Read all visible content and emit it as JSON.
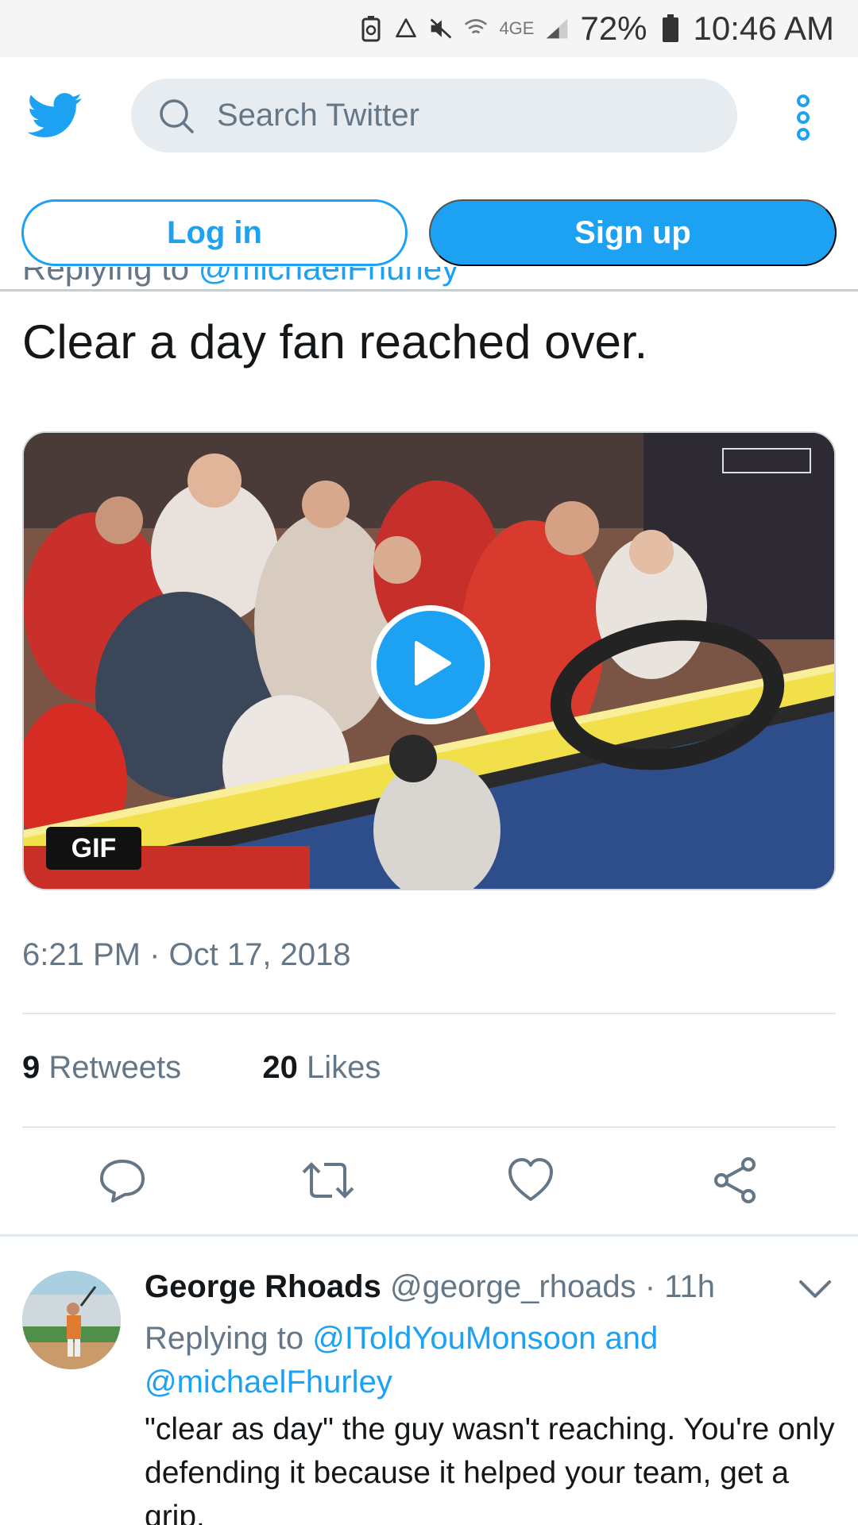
{
  "status_bar": {
    "network": "4GE",
    "battery": "72%",
    "time": "10:46 AM"
  },
  "header": {
    "search_placeholder": "Search Twitter",
    "login_label": "Log in",
    "signup_label": "Sign up"
  },
  "tweet": {
    "replying_prefix": "Replying to ",
    "replying_mention": "@michaelFhurley",
    "text": "Clear a day fan reached over.",
    "media_badge": "GIF",
    "timestamp": "6:21 PM · Oct 17, 2018",
    "retweets_count": "9",
    "retweets_label": "Retweets",
    "likes_count": "20",
    "likes_label": "Likes"
  },
  "reply": {
    "name": "George Rhoads",
    "handle": "@george_rhoads · 11h",
    "replying_prefix": "Replying to ",
    "mention1": "@IToldYouMonsoon",
    "and": " and ",
    "mention2": "@michaelFhurley",
    "text": "\"clear as day\" the guy wasn't reaching. You're only defending it because it helped your team, get a grip."
  },
  "colors": {
    "accent": "#1da1f2",
    "muted": "#657786",
    "text": "#14171a"
  },
  "icons": [
    "twitter-bird-icon",
    "search-icon",
    "more-vertical-icon",
    "play-icon",
    "reply-icon",
    "retweet-icon",
    "like-icon",
    "share-icon",
    "chevron-down-icon"
  ]
}
